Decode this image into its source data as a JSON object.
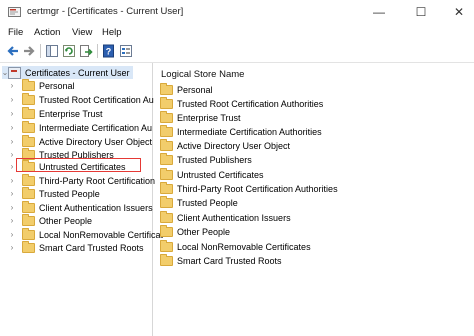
{
  "window": {
    "title": "certmgr - [Certificates - Current User]"
  },
  "window_controls": {
    "minimize": "—",
    "maximize": "☐",
    "close": "✕"
  },
  "menu": {
    "items": [
      "File",
      "Action",
      "View",
      "Help"
    ]
  },
  "toolbar": {
    "icons": [
      "back-arrow-icon",
      "forward-arrow-icon",
      "console-tree-icon",
      "refresh-icon",
      "export-list-icon",
      "help-icon",
      "properties-icon"
    ]
  },
  "tree": {
    "root": "Certificates - Current User",
    "items": [
      "Personal",
      "Trusted Root Certification Au",
      "Enterprise Trust",
      "Intermediate Certification Au",
      "Active Directory User Object",
      "Trusted Publishers",
      "Untrusted Certificates",
      "Third-Party Root Certification",
      "Trusted People",
      "Client Authentication Issuers",
      "Other People",
      "Local NonRemovable Certificat",
      "Smart Card Trusted Roots"
    ],
    "highlighted_item": "Untrusted Certificates",
    "highlight_color": "#e53935"
  },
  "list": {
    "column_header": "Logical Store Name",
    "items": [
      "Personal",
      "Trusted Root Certification Authorities",
      "Enterprise Trust",
      "Intermediate Certification Authorities",
      "Active Directory User Object",
      "Trusted Publishers",
      "Untrusted Certificates",
      "Third-Party Root Certification Authorities",
      "Trusted People",
      "Client Authentication Issuers",
      "Other People",
      "Local NonRemovable Certificates",
      "Smart Card Trusted Roots"
    ]
  }
}
